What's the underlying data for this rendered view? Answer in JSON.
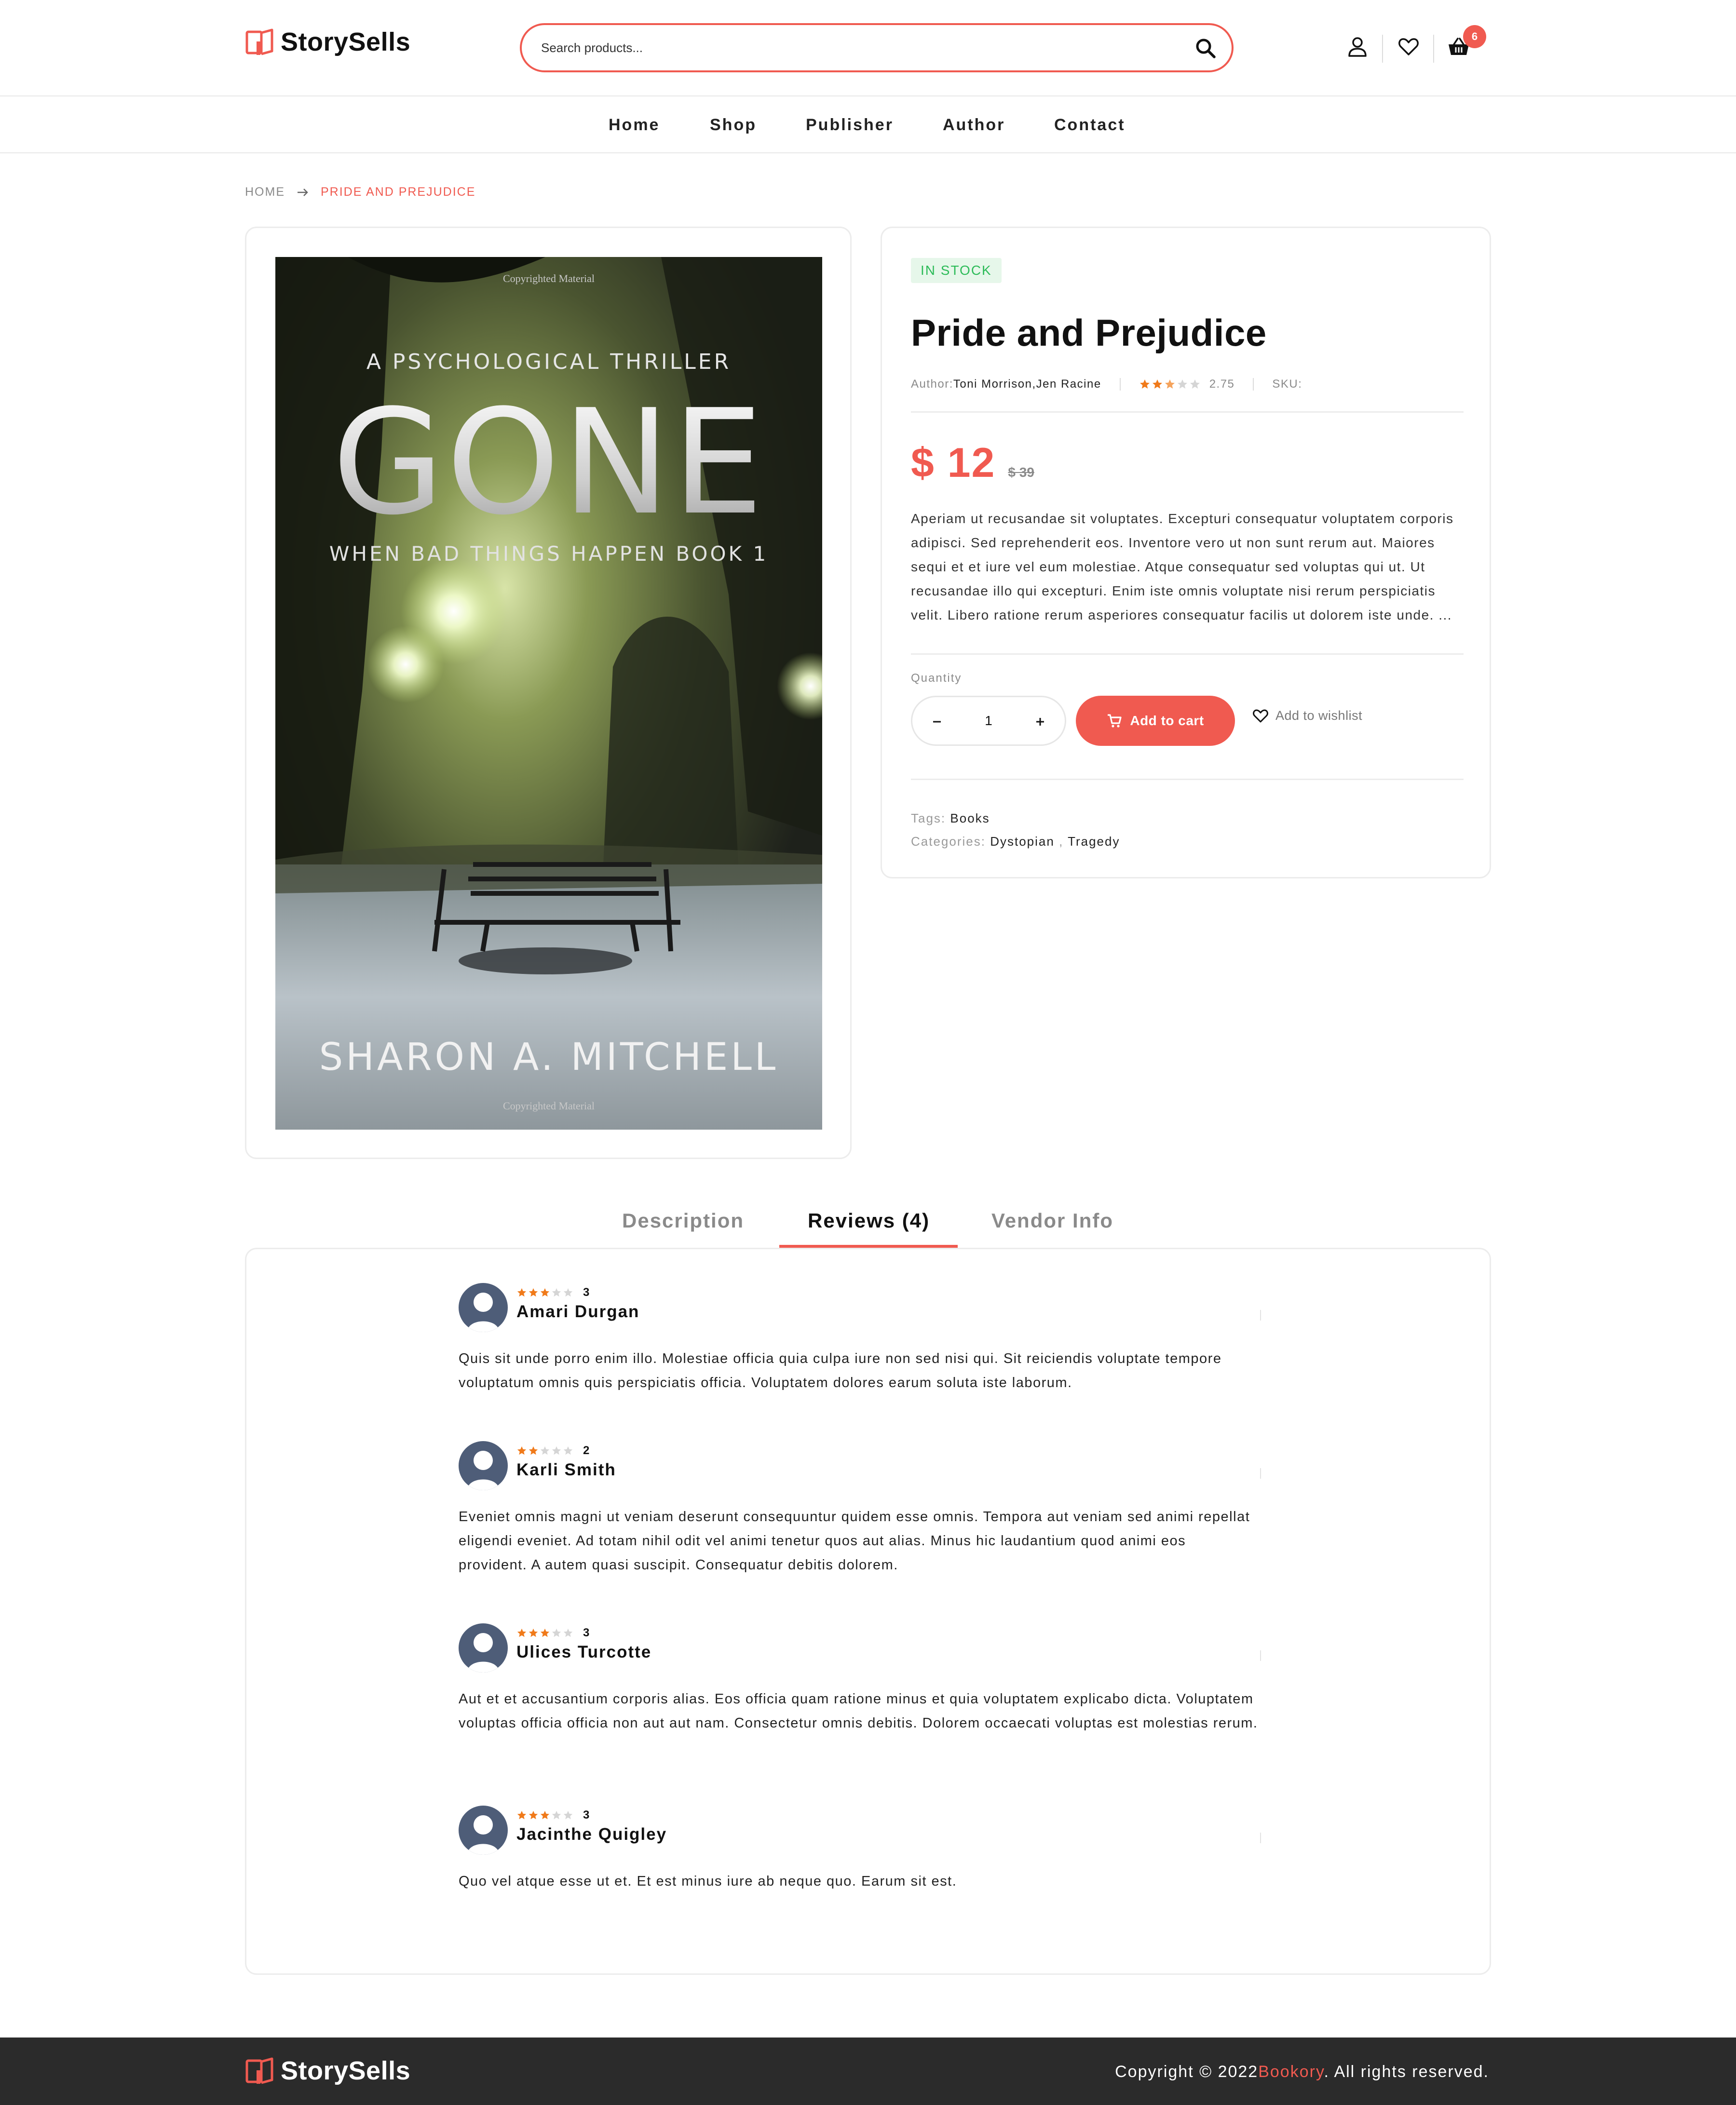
{
  "brand": {
    "name": "StorySells",
    "accent_color": "#f05a50"
  },
  "header": {
    "search_placeholder": "Search products...",
    "cart_count": "6",
    "icons": [
      "user-icon",
      "heart-icon",
      "basket-icon"
    ]
  },
  "nav": [
    "Home",
    "Shop",
    "Publisher",
    "Author",
    "Contact"
  ],
  "breadcrumb": {
    "home": "HOME",
    "current": "PRIDE AND PREJUDICE"
  },
  "cover": {
    "top_note": "Copyrighted Material",
    "tagline": "A PSYCHOLOGICAL THRILLER",
    "title": "GONE",
    "series": "WHEN BAD THINGS HAPPEN BOOK 1",
    "author": "SHARON A. MITCHELL",
    "bottom_note": "Copyrighted Material"
  },
  "product": {
    "stock": "IN STOCK",
    "title": "Pride and Prejudice",
    "author_label": "Author:",
    "authors": "Toni Morrison,Jen Racine",
    "rating": 2.75,
    "rating_text": "2.75",
    "sku_label": "SKU:",
    "price": "$ 12",
    "old_price": "$ 39",
    "description": "Aperiam ut recusandae sit voluptates. Excepturi consequatur voluptatem corporis adipisci. Sed reprehenderit eos. Inventore vero ut non sunt rerum aut. Maiores sequi et et iure vel eum molestiae. Atque consequatur sed voluptas qui ut. Ut recusandae illo qui excepturi. Enim iste omnis voluptate nisi rerum perspiciatis velit. Libero ratione rerum asperiores consequatur facilis ut dolorem iste unde. ...",
    "quantity_label": "Quantity",
    "quantity": "1",
    "add_to_cart": "Add to cart",
    "add_to_wishlist": "Add to wishlist",
    "tags_label": "Tags:",
    "tags": "Books",
    "categories_label": "Categories:",
    "categories": [
      "Dystopian",
      "Tragedy"
    ]
  },
  "tabs": {
    "description": "Description",
    "reviews": "Reviews (4)",
    "vendor": "Vendor Info",
    "active": "reviews"
  },
  "reviews": [
    {
      "name": "Amari Durgan",
      "rating": 3,
      "rating_text": "3",
      "text": "Quis sit unde porro enim illo. Molestiae officia quia culpa iure non sed nisi qui. Sit reiciendis voluptate tempore voluptatum omnis quis perspiciatis officia. Voluptatem dolores earum soluta iste laborum."
    },
    {
      "name": "Karli Smith",
      "rating": 2,
      "rating_text": "2",
      "text": "Eveniet omnis magni ut veniam deserunt consequuntur quidem esse omnis. Tempora aut veniam sed animi repellat eligendi eveniet. Ad totam nihil odit vel animi tenetur quos aut alias. Minus hic laudantium quod animi eos provident. A autem quasi suscipit. Consequatur debitis dolorem."
    },
    {
      "name": "Ulices Turcotte",
      "rating": 3,
      "rating_text": "3",
      "text": "Aut et et accusantium corporis alias. Eos officia quam ratione minus et quia voluptatem explicabo dicta. Voluptatem voluptas officia officia non aut aut nam. Consectetur omnis debitis. Dolorem occaecati voluptas est molestias rerum."
    },
    {
      "name": "Jacinthe Quigley",
      "rating": 3,
      "rating_text": "3",
      "text": "Quo vel atque esse ut et. Et est minus iure ab neque quo. Earum sit est."
    }
  ],
  "footer": {
    "copyright_prefix": "Copyright © 2022",
    "copyright_brand": "Bookory",
    "copyright_suffix": ". All rights reserved."
  }
}
